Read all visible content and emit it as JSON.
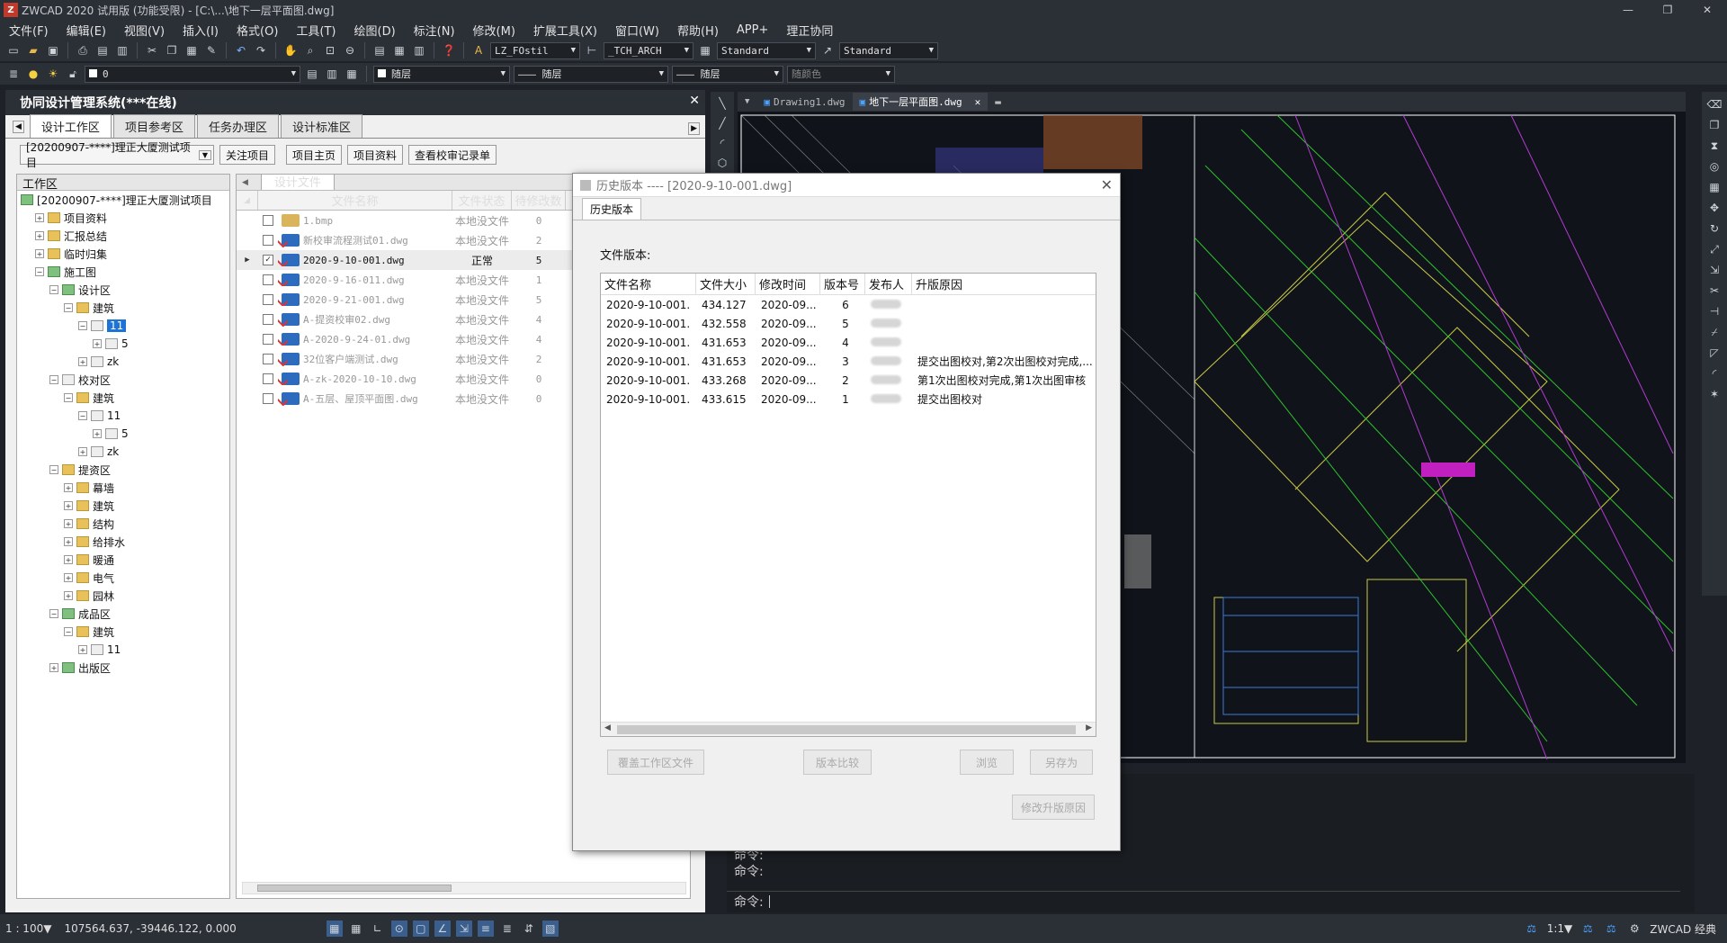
{
  "app": {
    "title": "ZWCAD 2020 试用版 (功能受限) - [C:\\...\\地下一层平面图.dwg]",
    "logo": "Z"
  },
  "window_buttons": [
    "—",
    "❐",
    "✕"
  ],
  "menu": [
    "文件(F)",
    "编辑(E)",
    "视图(V)",
    "插入(I)",
    "格式(O)",
    "工具(T)",
    "绘图(D)",
    "标注(N)",
    "修改(M)",
    "扩展工具(X)",
    "窗口(W)",
    "帮助(H)",
    "APP+",
    "理正协同"
  ],
  "toolbar1": {
    "text_style": "LZ_FOstil",
    "dim_style": "_TCH_ARCH",
    "table_style": "Standard",
    "multileader_style": "Standard"
  },
  "toolbar2": {
    "layer": "0",
    "color": "随层",
    "linetype": "随层",
    "lineweight": "随层",
    "plotstyle": "随颜色"
  },
  "left_panel": {
    "title": "协同设计管理系统(***在线)",
    "tabs": [
      "设计工作区",
      "项目参考区",
      "任务办理区",
      "设计标准区"
    ],
    "project_select": "[20200907-****]理正大厦测试项目",
    "buttons": [
      "关注项目",
      "项目主页",
      "项目资料",
      "查看校审记录单"
    ],
    "tree_header": "工作区",
    "tree": [
      {
        "label": "[20200907-****]理正大厦测试项目",
        "indent": 0,
        "icon": "g",
        "exp": ""
      },
      {
        "label": "项目资料",
        "indent": 1,
        "icon": "y",
        "exp": "+"
      },
      {
        "label": "汇报总结",
        "indent": 1,
        "icon": "y",
        "exp": "+"
      },
      {
        "label": "临时归集",
        "indent": 1,
        "icon": "y",
        "exp": "+"
      },
      {
        "label": "施工图",
        "indent": 1,
        "icon": "g",
        "exp": "−"
      },
      {
        "label": "设计区",
        "indent": 2,
        "icon": "g",
        "exp": "−"
      },
      {
        "label": "建筑",
        "indent": 3,
        "icon": "y",
        "exp": "−"
      },
      {
        "label": "11",
        "indent": 4,
        "icon": "b",
        "exp": "−",
        "selected": true
      },
      {
        "label": "5",
        "indent": 5,
        "icon": "b",
        "exp": "+"
      },
      {
        "label": "zk",
        "indent": 4,
        "icon": "b",
        "exp": "+"
      },
      {
        "label": "校对区",
        "indent": 2,
        "icon": "b",
        "exp": "−"
      },
      {
        "label": "建筑",
        "indent": 3,
        "icon": "y",
        "exp": "−"
      },
      {
        "label": "11",
        "indent": 4,
        "icon": "b",
        "exp": "−"
      },
      {
        "label": "5",
        "indent": 5,
        "icon": "b",
        "exp": "+"
      },
      {
        "label": "zk",
        "indent": 4,
        "icon": "b",
        "exp": "+"
      },
      {
        "label": "提资区",
        "indent": 2,
        "icon": "y",
        "exp": "−"
      },
      {
        "label": "幕墙",
        "indent": 3,
        "icon": "y",
        "exp": "+"
      },
      {
        "label": "建筑",
        "indent": 3,
        "icon": "y",
        "exp": "+"
      },
      {
        "label": "结构",
        "indent": 3,
        "icon": "y",
        "exp": "+"
      },
      {
        "label": "给排水",
        "indent": 3,
        "icon": "y",
        "exp": "+"
      },
      {
        "label": "暖通",
        "indent": 3,
        "icon": "y",
        "exp": "+"
      },
      {
        "label": "电气",
        "indent": 3,
        "icon": "y",
        "exp": "+"
      },
      {
        "label": "园林",
        "indent": 3,
        "icon": "y",
        "exp": "+"
      },
      {
        "label": "成品区",
        "indent": 2,
        "icon": "g",
        "exp": "−"
      },
      {
        "label": "建筑",
        "indent": 3,
        "icon": "y",
        "exp": "−"
      },
      {
        "label": "11",
        "indent": 4,
        "icon": "b",
        "exp": "+"
      },
      {
        "label": "出版区",
        "indent": 2,
        "icon": "g",
        "exp": "+"
      }
    ],
    "file_tab": "设计文件",
    "file_columns": [
      "文件名称",
      "文件状态",
      "待修改数"
    ],
    "files": [
      {
        "name": "1.bmp",
        "status": "本地没文件",
        "count": "0",
        "type": "bmp",
        "checked": false,
        "current": false
      },
      {
        "name": "新校审流程测试01.dwg",
        "status": "本地没文件",
        "count": "2",
        "type": "dwg",
        "checked": false,
        "current": false
      },
      {
        "name": "2020-9-10-001.dwg",
        "status": "正常",
        "count": "5",
        "type": "dwg",
        "checked": true,
        "current": true
      },
      {
        "name": "2020-9-16-011.dwg",
        "status": "本地没文件",
        "count": "1",
        "type": "dwg",
        "checked": false,
        "current": false
      },
      {
        "name": "2020-9-21-001.dwg",
        "status": "本地没文件",
        "count": "5",
        "type": "dwg",
        "checked": false,
        "current": false
      },
      {
        "name": "A-提资校审02.dwg",
        "status": "本地没文件",
        "count": "4",
        "type": "dwg",
        "checked": false,
        "current": false
      },
      {
        "name": "A-2020-9-24-01.dwg",
        "status": "本地没文件",
        "count": "4",
        "type": "dwg",
        "checked": false,
        "current": false
      },
      {
        "name": "32位客户端测试.dwg",
        "status": "本地没文件",
        "count": "2",
        "type": "dwg",
        "checked": false,
        "current": false
      },
      {
        "name": "A-zk-2020-10-10.dwg",
        "status": "本地没文件",
        "count": "0",
        "type": "dwg",
        "checked": false,
        "current": false
      },
      {
        "name": "A-五层、屋顶平面图.dwg",
        "status": "本地没文件",
        "count": "0",
        "type": "dwg",
        "checked": false,
        "current": false
      }
    ]
  },
  "cad_tabs": [
    {
      "label": "Drawing1.dwg",
      "active": false
    },
    {
      "label": "地下一层平面图.dwg",
      "active": true
    }
  ],
  "dialog": {
    "title": "历史版本 ---- [2020-9-10-001.dwg]",
    "tab": "历史版本",
    "label": "文件版本:",
    "columns": [
      "文件名称",
      "文件大小",
      "修改时间",
      "版本号",
      "发布人",
      "升版原因"
    ],
    "rows": [
      {
        "name": "2020-9-10-001.",
        "size": "434.127",
        "time": "2020-09...",
        "ver": "6",
        "reason": ""
      },
      {
        "name": "2020-9-10-001.",
        "size": "432.558",
        "time": "2020-09...",
        "ver": "5",
        "reason": ""
      },
      {
        "name": "2020-9-10-001.",
        "size": "431.653",
        "time": "2020-09...",
        "ver": "4",
        "reason": ""
      },
      {
        "name": "2020-9-10-001.",
        "size": "431.653",
        "time": "2020-09...",
        "ver": "3",
        "reason": "提交出图校对,第2次出图校对完成,..."
      },
      {
        "name": "2020-9-10-001.",
        "size": "433.268",
        "time": "2020-09...",
        "ver": "2",
        "reason": "第1次出图校对完成,第1次出图审核"
      },
      {
        "name": "2020-9-10-001.",
        "size": "433.615",
        "time": "2020-09...",
        "ver": "1",
        "reason": "提交出图校对"
      }
    ],
    "buttons": {
      "overwrite": "覆盖工作区文件",
      "compare": "版本比较",
      "browse": "浏览",
      "saveas": "另存为",
      "edit_reason": "修改升版原因"
    }
  },
  "command": {
    "history": [
      "命令:",
      "命令:"
    ],
    "prompt": "命令:"
  },
  "status": {
    "scale": "1 : 100▼",
    "coords": "107564.637, -39446.122, 0.000",
    "anno_scale": "1:1▼",
    "workspace": "ZWCAD 经典"
  }
}
